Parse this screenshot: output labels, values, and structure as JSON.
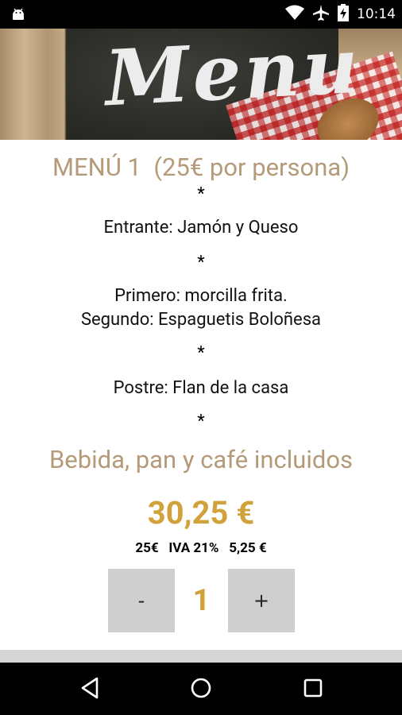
{
  "status_bar": {
    "time": "10:14",
    "icons": [
      "android-icon",
      "wifi-icon",
      "airplane-icon",
      "battery-charging-icon"
    ]
  },
  "header": {
    "image_text": "Menu"
  },
  "menu": {
    "title": "MENÚ 1  (25€ por persona)",
    "separator": "*",
    "starter": "Entrante: Jamón y Queso",
    "first_course": "Primero: morcilla frita.",
    "second_course": "Segundo: Espaguetis Boloñesa",
    "dessert": "Postre: Flan de la casa",
    "included": "Bebida, pan y café incluidos"
  },
  "pricing": {
    "total": "30,25 €",
    "base": "25€",
    "tax_label": "IVA 21%",
    "tax_amount": "5,25 €",
    "accent_color": "#d1a13c",
    "title_color": "#b49a78"
  },
  "stepper": {
    "minus_label": "-",
    "quantity": "1",
    "plus_label": "+"
  },
  "nav_bar": {
    "buttons": [
      "back-icon",
      "home-icon",
      "recents-icon"
    ]
  }
}
